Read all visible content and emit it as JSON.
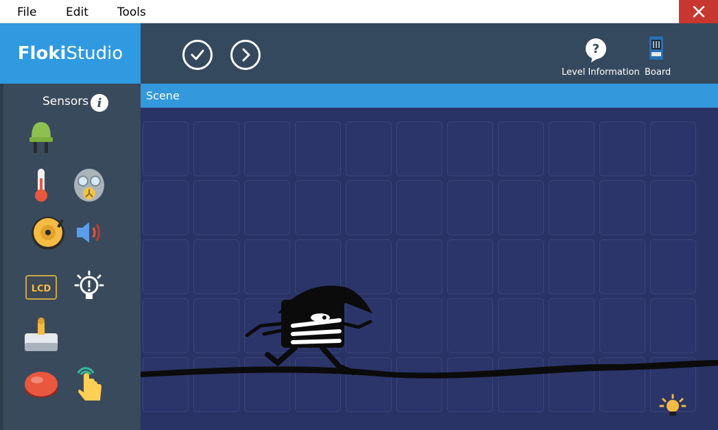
{
  "menu": {
    "file": "File",
    "edit": "Edit",
    "tools": "Tools"
  },
  "app": {
    "logo_bold": "Floki",
    "logo_light": "Studio"
  },
  "toolbar": {
    "level_info_label": "Level Information",
    "board_label": "Board"
  },
  "sidebar": {
    "title": "Sensors"
  },
  "scene": {
    "title": "Scene"
  },
  "colors": {
    "accent": "#3499dc",
    "sidebar": "#394a5c",
    "toolbar": "#35495e",
    "scene_bg": "#2a3366",
    "close": "#c7372f"
  }
}
